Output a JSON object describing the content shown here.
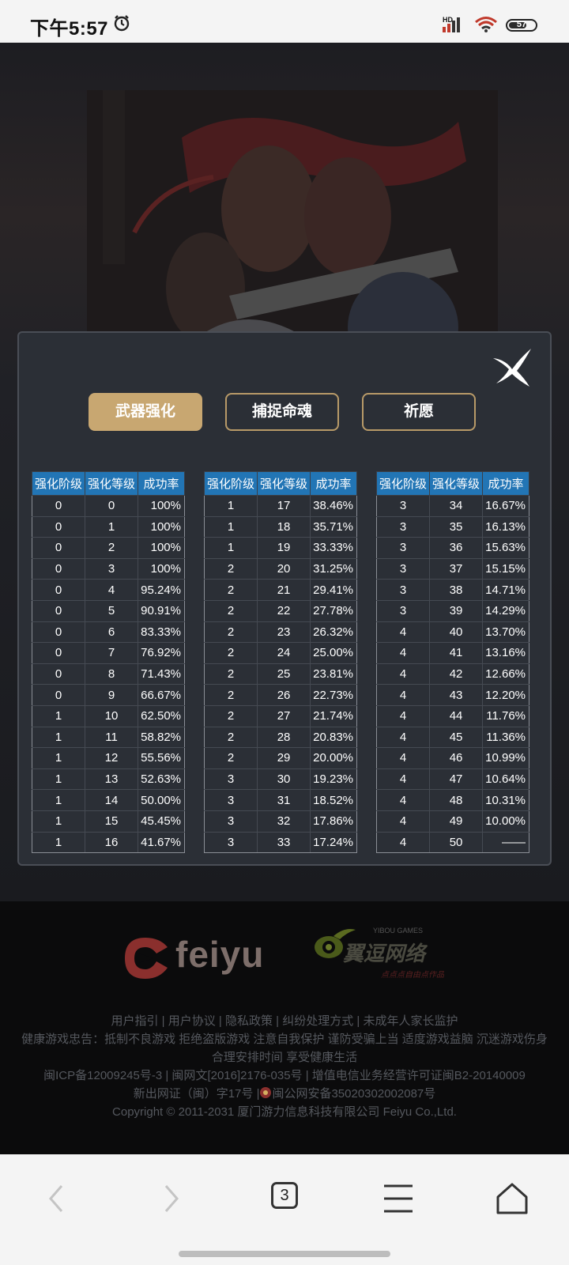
{
  "status_bar": {
    "time": "下午5:57",
    "battery": "57",
    "signal_label": "HD"
  },
  "tabs": [
    {
      "label": "武器强化",
      "active": true
    },
    {
      "label": "捕捉命魂",
      "active": false
    },
    {
      "label": "祈愿",
      "active": false
    }
  ],
  "table": {
    "headers": [
      "强化阶级",
      "强化等级",
      "成功率"
    ],
    "columns": [
      [
        [
          "0",
          "0",
          "100%"
        ],
        [
          "0",
          "1",
          "100%"
        ],
        [
          "0",
          "2",
          "100%"
        ],
        [
          "0",
          "3",
          "100%"
        ],
        [
          "0",
          "4",
          "95.24%"
        ],
        [
          "0",
          "5",
          "90.91%"
        ],
        [
          "0",
          "6",
          "83.33%"
        ],
        [
          "0",
          "7",
          "76.92%"
        ],
        [
          "0",
          "8",
          "71.43%"
        ],
        [
          "0",
          "9",
          "66.67%"
        ],
        [
          "1",
          "10",
          "62.50%"
        ],
        [
          "1",
          "11",
          "58.82%"
        ],
        [
          "1",
          "12",
          "55.56%"
        ],
        [
          "1",
          "13",
          "52.63%"
        ],
        [
          "1",
          "14",
          "50.00%"
        ],
        [
          "1",
          "15",
          "45.45%"
        ],
        [
          "1",
          "16",
          "41.67%"
        ]
      ],
      [
        [
          "1",
          "17",
          "38.46%"
        ],
        [
          "1",
          "18",
          "35.71%"
        ],
        [
          "1",
          "19",
          "33.33%"
        ],
        [
          "2",
          "20",
          "31.25%"
        ],
        [
          "2",
          "21",
          "29.41%"
        ],
        [
          "2",
          "22",
          "27.78%"
        ],
        [
          "2",
          "23",
          "26.32%"
        ],
        [
          "2",
          "24",
          "25.00%"
        ],
        [
          "2",
          "25",
          "23.81%"
        ],
        [
          "2",
          "26",
          "22.73%"
        ],
        [
          "2",
          "27",
          "21.74%"
        ],
        [
          "2",
          "28",
          "20.83%"
        ],
        [
          "2",
          "29",
          "20.00%"
        ],
        [
          "3",
          "30",
          "19.23%"
        ],
        [
          "3",
          "31",
          "18.52%"
        ],
        [
          "3",
          "32",
          "17.86%"
        ],
        [
          "3",
          "33",
          "17.24%"
        ]
      ],
      [
        [
          "3",
          "34",
          "16.67%"
        ],
        [
          "3",
          "35",
          "16.13%"
        ],
        [
          "3",
          "36",
          "15.63%"
        ],
        [
          "3",
          "37",
          "15.15%"
        ],
        [
          "3",
          "38",
          "14.71%"
        ],
        [
          "3",
          "39",
          "14.29%"
        ],
        [
          "4",
          "40",
          "13.70%"
        ],
        [
          "4",
          "41",
          "13.16%"
        ],
        [
          "4",
          "42",
          "12.66%"
        ],
        [
          "4",
          "43",
          "12.20%"
        ],
        [
          "4",
          "44",
          "11.76%"
        ],
        [
          "4",
          "45",
          "11.36%"
        ],
        [
          "4",
          "46",
          "10.99%"
        ],
        [
          "4",
          "47",
          "10.64%"
        ],
        [
          "4",
          "48",
          "10.31%"
        ],
        [
          "4",
          "49",
          "10.00%"
        ],
        [
          "4",
          "50",
          "——"
        ]
      ]
    ]
  },
  "footer": {
    "brand": "feiyu",
    "partner_en": "YIBOU GAMES",
    "partner_cn": "翼逗网络",
    "partner_slogan": "点点点自由点作品",
    "links": [
      "用户指引",
      "用户协议",
      "隐私政策",
      "纠纷处理方式",
      "未成年人家长监护"
    ],
    "health_1": "健康游戏忠告：抵制不良游戏 拒绝盗版游戏 注意自我保护 谨防受骗上当 适度游戏益脑 沉迷游戏伤身",
    "health_2": "合理安排时间 享受健康生活",
    "icp": "闽ICP备12009245号-3 | 闽网文[2016]2176-035号 | 增值电信业务经营许可证闽B2-20140009",
    "publish": "新出网证（闽）字17号 |",
    "police": "闽公网安备35020302002087号",
    "copyright": "Copyright © 2011-2031 厦门游力信息科技有限公司 Feiyu Co.,Ltd."
  },
  "browser_nav": {
    "tab_count": "3"
  },
  "colors": {
    "accent_gold": "#c8a771",
    "table_header": "#2275b5",
    "modal_bg": "#2b2f36"
  }
}
